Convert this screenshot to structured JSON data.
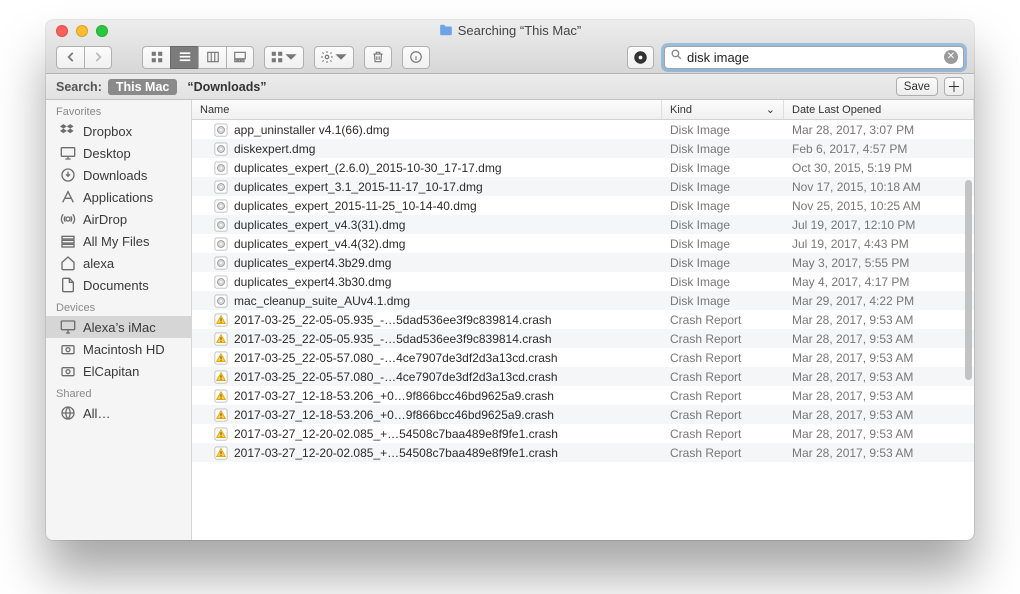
{
  "window_title": "Searching “This Mac”",
  "search": {
    "value": "disk image"
  },
  "scope": {
    "label": "Search:",
    "selected": "This Mac",
    "other": "“Downloads”",
    "save": "Save"
  },
  "columns": {
    "name": "Name",
    "kind": "Kind",
    "date": "Date Last Opened"
  },
  "sidebar": {
    "favorites_head": "Favorites",
    "devices_head": "Devices",
    "shared_head": "Shared",
    "favorites": [
      {
        "label": "Dropbox",
        "icon": "dropbox"
      },
      {
        "label": "Desktop",
        "icon": "desktop"
      },
      {
        "label": "Downloads",
        "icon": "downloads"
      },
      {
        "label": "Applications",
        "icon": "apps"
      },
      {
        "label": "AirDrop",
        "icon": "airdrop"
      },
      {
        "label": "All My Files",
        "icon": "allfiles"
      },
      {
        "label": "alexa",
        "icon": "home"
      },
      {
        "label": "Documents",
        "icon": "documents"
      }
    ],
    "devices": [
      {
        "label": "Alexa’s iMac",
        "icon": "imac",
        "selected": true
      },
      {
        "label": "Macintosh HD",
        "icon": "hdd"
      },
      {
        "label": "ElCapitan",
        "icon": "hdd"
      }
    ],
    "shared": [
      {
        "label": "All…",
        "icon": "globe"
      }
    ]
  },
  "rows": [
    {
      "name": "app_uninstaller v4.1(66).dmg",
      "kind": "Disk Image",
      "date": "Mar 28, 2017, 3:07 PM",
      "type": "dmg"
    },
    {
      "name": "diskexpert.dmg",
      "kind": "Disk Image",
      "date": "Feb 6, 2017, 4:57 PM",
      "type": "dmg"
    },
    {
      "name": "duplicates_expert_(2.6.0)_2015-10-30_17-17.dmg",
      "kind": "Disk Image",
      "date": "Oct 30, 2015, 5:19 PM",
      "type": "dmg"
    },
    {
      "name": "duplicates_expert_3.1_2015-11-17_10-17.dmg",
      "kind": "Disk Image",
      "date": "Nov 17, 2015, 10:18 AM",
      "type": "dmg"
    },
    {
      "name": "duplicates_expert_2015-11-25_10-14-40.dmg",
      "kind": "Disk Image",
      "date": "Nov 25, 2015, 10:25 AM",
      "type": "dmg"
    },
    {
      "name": "duplicates_expert_v4.3(31).dmg",
      "kind": "Disk Image",
      "date": "Jul 19, 2017, 12:10 PM",
      "type": "dmg"
    },
    {
      "name": "duplicates_expert_v4.4(32).dmg",
      "kind": "Disk Image",
      "date": "Jul 19, 2017, 4:43 PM",
      "type": "dmg"
    },
    {
      "name": "duplicates_expert4.3b29.dmg",
      "kind": "Disk Image",
      "date": "May 3, 2017, 5:55 PM",
      "type": "dmg"
    },
    {
      "name": "duplicates_expert4.3b30.dmg",
      "kind": "Disk Image",
      "date": "May 4, 2017, 4:17 PM",
      "type": "dmg"
    },
    {
      "name": "mac_cleanup_suite_AUv4.1.dmg",
      "kind": "Disk Image",
      "date": "Mar 29, 2017, 4:22 PM",
      "type": "dmg"
    },
    {
      "name": "2017-03-25_22-05-05.935_-…5dad536ee3f9c839814.crash",
      "kind": "Crash Report",
      "date": "Mar 28, 2017, 9:53 AM",
      "type": "crash"
    },
    {
      "name": "2017-03-25_22-05-05.935_-…5dad536ee3f9c839814.crash",
      "kind": "Crash Report",
      "date": "Mar 28, 2017, 9:53 AM",
      "type": "crash"
    },
    {
      "name": "2017-03-25_22-05-57.080_-…4ce7907de3df2d3a13cd.crash",
      "kind": "Crash Report",
      "date": "Mar 28, 2017, 9:53 AM",
      "type": "crash"
    },
    {
      "name": "2017-03-25_22-05-57.080_-…4ce7907de3df2d3a13cd.crash",
      "kind": "Crash Report",
      "date": "Mar 28, 2017, 9:53 AM",
      "type": "crash"
    },
    {
      "name": "2017-03-27_12-18-53.206_+0…9f866bcc46bd9625a9.crash",
      "kind": "Crash Report",
      "date": "Mar 28, 2017, 9:53 AM",
      "type": "crash"
    },
    {
      "name": "2017-03-27_12-18-53.206_+0…9f866bcc46bd9625a9.crash",
      "kind": "Crash Report",
      "date": "Mar 28, 2017, 9:53 AM",
      "type": "crash"
    },
    {
      "name": "2017-03-27_12-20-02.085_+…54508c7baa489e8f9fe1.crash",
      "kind": "Crash Report",
      "date": "Mar 28, 2017, 9:53 AM",
      "type": "crash"
    },
    {
      "name": "2017-03-27_12-20-02.085_+…54508c7baa489e8f9fe1.crash",
      "kind": "Crash Report",
      "date": "Mar 28, 2017, 9:53 AM",
      "type": "crash"
    }
  ],
  "icons": {
    "sidebar": {
      "dropbox": "<svg viewBox='0 0 24 24' fill='#6d6d6d'><path d='M6 2l6 4-6 4-6-4zM18 2l6 4-6 4-6-4zM6 10l6 4-6 4-6-4zM18 10l6 4-6 4-6-4z' transform='scale(0.85)'/></svg>",
      "desktop": "<svg viewBox='0 0 24 24' fill='none' stroke='#6d6d6d' stroke-width='2'><rect x='2' y='4' width='20' height='13' rx='1'/><path d='M8 21h8M12 17v4'/></svg>",
      "downloads": "<svg viewBox='0 0 24 24' fill='none' stroke='#6d6d6d' stroke-width='2'><circle cx='12' cy='12' r='9'/><path d='M12 7v7m-3-3l3 3 3-3'/></svg>",
      "apps": "<svg viewBox='0 0 24 24' fill='none' stroke='#6d6d6d' stroke-width='2'><path d='M4 20l8-16 8 16M7 14h10'/></svg>",
      "airdrop": "<svg viewBox='0 0 24 24' fill='none' stroke='#6d6d6d' stroke-width='2'><circle cx='12' cy='12' r='3'/><path d='M5 5a10 10 0 000 14M19 5a10 10 0 010 14M8 8a6 6 0 000 8M16 8a6 6 0 010 8'/></svg>",
      "allfiles": "<svg viewBox='0 0 24 24' fill='none' stroke='#6d6d6d' stroke-width='2'><rect x='3' y='5' width='18' height='4'/><rect x='3' y='11' width='18' height='4'/><rect x='3' y='17' width='18' height='4'/></svg>",
      "home": "<svg viewBox='0 0 24 24' fill='none' stroke='#6d6d6d' stroke-width='2'><path d='M3 11l9-8 9 8v9a2 2 0 01-2 2H5a2 2 0 01-2-2z'/></svg>",
      "documents": "<svg viewBox='0 0 24 24' fill='none' stroke='#6d6d6d' stroke-width='2'><path d='M14 2H6a2 2 0 00-2 2v16a2 2 0 002 2h12a2 2 0 002-2V8z'/><path d='M14 2v6h6'/></svg>",
      "imac": "<svg viewBox='0 0 24 24' fill='none' stroke='#6d6d6d' stroke-width='2'><rect x='2' y='3' width='20' height='13' rx='1'/><path d='M9 21h6M12 16v5'/></svg>",
      "hdd": "<svg viewBox='0 0 24 24' fill='none' stroke='#6d6d6d' stroke-width='2'><rect x='3' y='7' width='18' height='12' rx='2'/><circle cx='12' cy='13' r='3'/></svg>",
      "globe": "<svg viewBox='0 0 24 24' fill='none' stroke='#6d6d6d' stroke-width='2'><circle cx='12' cy='12' r='9'/><path d='M3 12h18M12 3a14 14 0 010 18M12 3a14 14 0 000 18'/></svg>"
    },
    "file": {
      "dmg": "<svg viewBox='0 0 16 16'><rect x='1' y='1' width='14' height='14' rx='2' fill='#fff' stroke='#bbb'/><circle cx='8' cy='8' r='4' fill='#d8d8d8' stroke='#999'/><circle cx='8' cy='8' r='1.2' fill='#fff'/></svg>",
      "crash": "<svg viewBox='0 0 16 16'><rect x='1' y='1' width='14' height='14' rx='2' fill='#fff' stroke='#bbb'/><path d='M8 3l5 9H3z' fill='#ffcc4d' stroke='#e0a800'/><rect x='7.4' y='6' width='1.2' height='3' fill='#6b4b00'/><rect x='7.4' y='10' width='1.2' height='1.2' fill='#6b4b00'/></svg>"
    }
  }
}
